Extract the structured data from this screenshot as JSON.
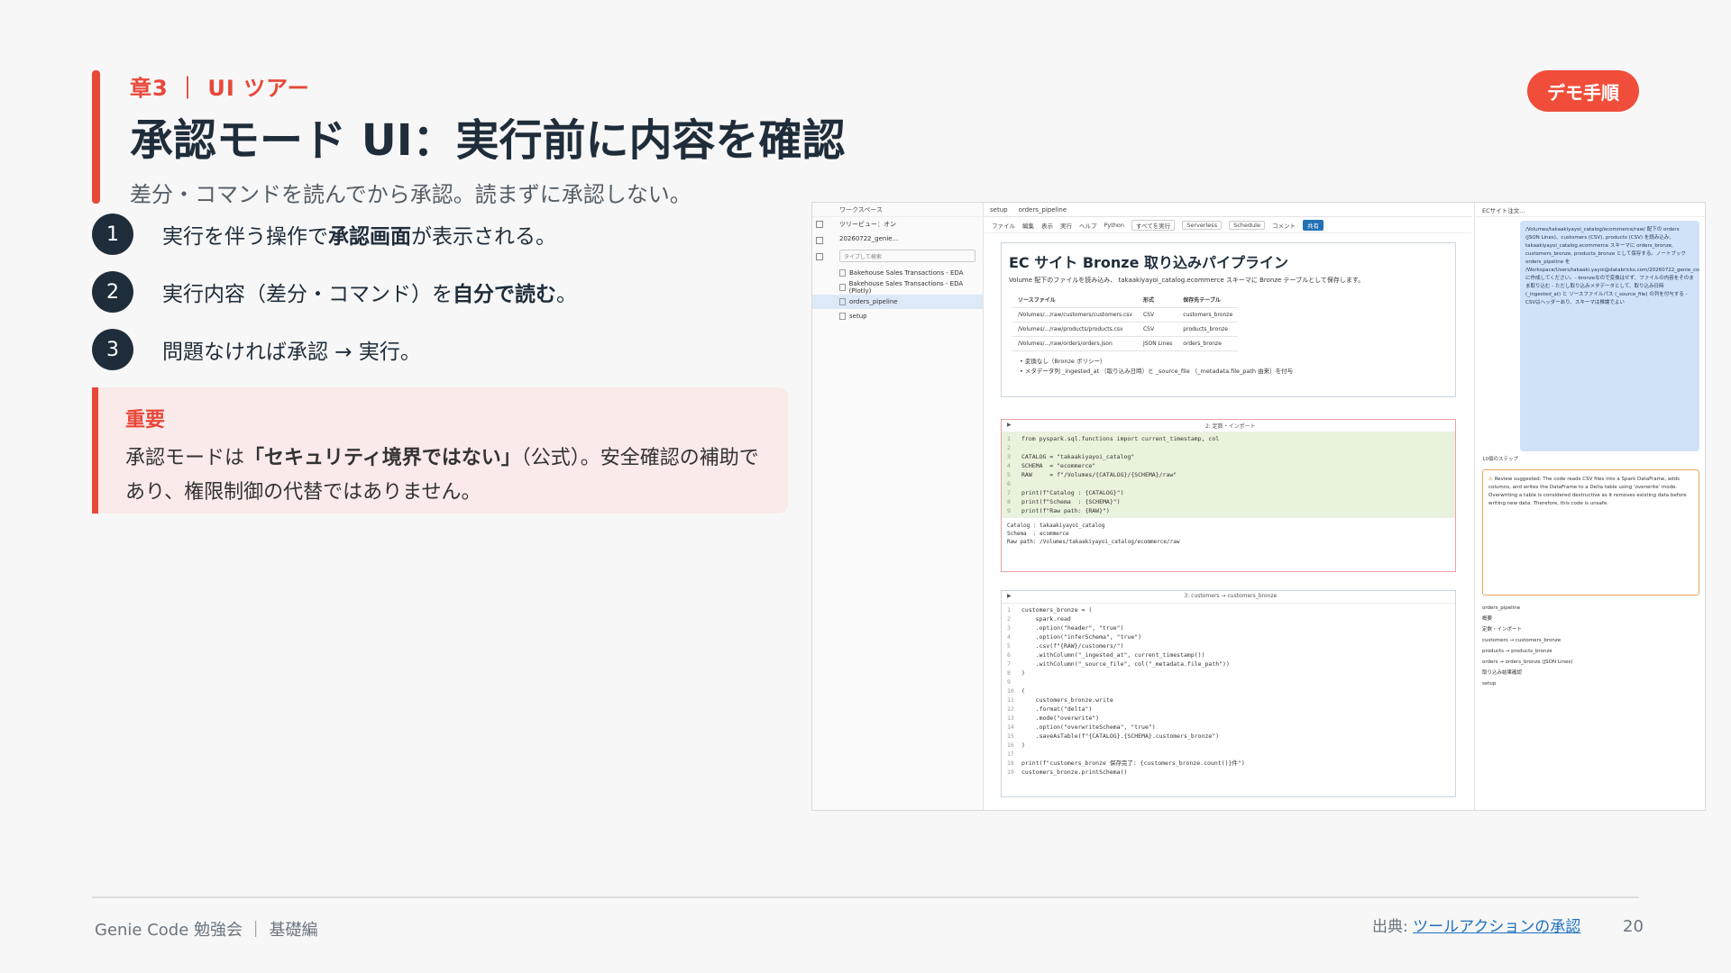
{
  "slide": {
    "chapter": "章3 ｜ UI ツアー",
    "title": "承認モード UI：実行前に内容を確認",
    "subtitle": "差分・コマンドを読んでから承認。読まずに承認しない。",
    "badge": "デモ手順"
  },
  "steps": [
    {
      "num": "1",
      "pre": "実行を伴う操作で",
      "bold": "承認画面",
      "post": "が表示される。"
    },
    {
      "num": "2",
      "pre": "実行内容（差分・コマンド）を",
      "bold": "自分で読む",
      "post": "。"
    },
    {
      "num": "3",
      "pre": "問題なければ承認 → 実行。",
      "bold": "",
      "post": ""
    }
  ],
  "callout": {
    "heading": "重要",
    "pre": "承認モードは",
    "bold": "「セキュリティ境界ではない」",
    "post": "（公式）。安全確認の補助であり、権限制御の代替ではありません。"
  },
  "footer": {
    "left": "Genie Code 勉強会 ｜ 基礎編",
    "source_label": "出典:",
    "source_link": "ツールアクションの承認",
    "page": "20"
  },
  "screenshot": {
    "nav": {
      "workspace": "ワークスペース",
      "tree_label": "ツリービュー：オン",
      "path": "20260722_genie...",
      "search_placeholder": "タイプして検索",
      "items": [
        "Bakehouse Sales Transactions - EDA",
        "Bakehouse Sales Transactions - EDA (Plotly)",
        "orders_pipeline",
        "setup"
      ]
    },
    "tabs": [
      "setup",
      "orders_pipeline"
    ],
    "toolbar": [
      "ファイル",
      "編集",
      "表示",
      "実行",
      "ヘルプ",
      "Python",
      "すべてを実行",
      "Serverless",
      "Schedule",
      "コメント",
      "共有"
    ],
    "md": {
      "title": "EC サイト Bronze 取り込みパイプライン",
      "desc": "Volume 配下のファイルを読み込み、 takaakiyayoi_catalog.ecommerce スキーマに Bronze テーブルとして保存します。",
      "headers": [
        "ソースファイル",
        "形式",
        "保存先テーブル"
      ],
      "rows": [
        [
          "/Volumes/.../raw/customers/customers.csv",
          "CSV",
          "customers_bronze"
        ],
        [
          "/Volumes/.../raw/products/products.csv",
          "CSV",
          "products_bronze"
        ],
        [
          "/Volumes/.../raw/orders/orders.json",
          "JSON Lines",
          "orders_bronze"
        ]
      ],
      "bullets": [
        "変換なし（Bronze ポリシー）",
        "メタデータ列 _ingested_at （取り込み日時）と _source_file （_metadata.file_path 由来）を付与"
      ]
    },
    "cell1_title": "2: 定数・インポート",
    "cell1_code": [
      "from pyspark.sql.functions import current_timestamp, col",
      "",
      "CATALOG = \"takaakiyayoi_catalog\"",
      "SCHEMA  = \"ecommerce\"",
      "RAW     = f\"/Volumes/{CATALOG}/{SCHEMA}/raw\"",
      "",
      "print(f\"Catalog : {CATALOG}\")",
      "print(f\"Schema  : {SCHEMA}\")",
      "print(f\"Raw path: {RAW}\")"
    ],
    "cell1_out": "Catalog : takaakiyayoi_catalog\nSchema  : ecommerce\nRaw path: /Volumes/takaakiyayoi_catalog/ecommerce/raw",
    "cell2_title": "3: customers → customers_bronze",
    "cell2_code": [
      "customers_bronze = (",
      "    spark.read",
      "    .option(\"header\", \"true\")",
      "    .option(\"inferSchema\", \"true\")",
      "    .csv(f\"{RAW}/customers/\")",
      "    .withColumn(\"_ingested_at\", current_timestamp())",
      "    .withColumn(\"_source_file\", col(\"_metadata.file_path\"))",
      ")",
      "",
      "(",
      "    customers_bronze.write",
      "    .format(\"delta\")",
      "    .mode(\"overwrite\")",
      "    .option(\"overwriteSchema\", \"true\")",
      "    .saveAsTable(f\"{CATALOG}.{SCHEMA}.customers_bronze\")",
      ")",
      "",
      "print(f\"customers_bronze 保存完了: {customers_bronze.count()}件\")",
      "customers_bronze.printSchema()"
    ],
    "chat": {
      "top": "ECサイト注文...",
      "bubble": "/Volumes/takaakiyayoi_catalog/ecommerce/raw/ 配下の orders (JSON Lines)、customers (CSV), products (CSV) を読み込み、takaakiyayoi_catalog.ecommerce スキーマに orders_bronze, customers_bronze, products_bronze として保存する。ノートブック orders_pipeline を /Workspace/Users/takaaki.yayoi@databricks.com/20260722_genie_code_walk_through/ に作成してください。- bronzeなので変換はせず、ファイルの内容をそのまま取り込む - ただし取り込みメタデータとして、取り込み日時 (_ingested_at) と ソースファイルパス (_source_file) の列を付与する - CSVはヘッダーあり、スキーマは推論でよい",
      "steps_done": "10個のステップ",
      "review": "Review suggested: The code reads CSV files into a Spark DataFrame, adds columns, and writes the DataFrame to a Delta table using 'overwrite' mode. Overwriting a table is considered destructive as it removes existing data before writing new data. Therefore, this code is unsafe.",
      "assets": [
        "orders_pipeline",
        "概要",
        "定数・インポート",
        "customers → customers_bronze",
        "products → products_bronze",
        "orders → orders_bronze (JSON Lines)",
        "取り込み結果確認",
        "setup"
      ]
    }
  }
}
